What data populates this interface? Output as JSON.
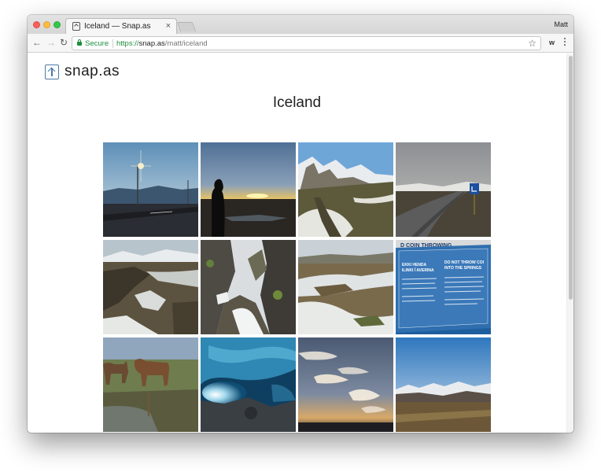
{
  "browser": {
    "tab_title": "Iceland — Snap.as",
    "tab_close": "×",
    "profile_name": "Matt",
    "secure_label": "Secure",
    "url_scheme": "https://",
    "url_host": "snap.as",
    "url_path": "/matt/iceland",
    "ext_label": "w"
  },
  "site": {
    "logo_text": "snap.as",
    "album_title": "Iceland"
  },
  "colors": {
    "brand_icon": "#4a7aa6",
    "secure_green": "#1e8e3e"
  },
  "photos": [
    {
      "id": "streetlight-sunset"
    },
    {
      "id": "silhouette-sunset"
    },
    {
      "id": "snowy-mountains"
    },
    {
      "id": "road-sign"
    },
    {
      "id": "rift-valley"
    },
    {
      "id": "rocky-gorge"
    },
    {
      "id": "snowy-field"
    },
    {
      "id": "coin-throwing-sign"
    },
    {
      "id": "icelandic-horses"
    },
    {
      "id": "ice-cave"
    },
    {
      "id": "sunset-clouds"
    },
    {
      "id": "distant-mountains"
    }
  ],
  "sign_text": {
    "header": "D COIN THROWING",
    "left_1": "EKKI HENDA",
    "left_2": "ILINKI Í AVERINA",
    "right_1": "DO NOT THROW COI",
    "right_2": "INTO THE SPRINGS"
  }
}
